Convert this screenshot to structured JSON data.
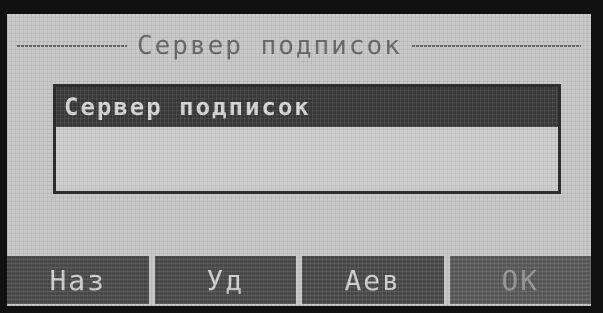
{
  "header": {
    "title": "Сервер подписок"
  },
  "field": {
    "selected_value": "Сервер подписок",
    "input_value": ""
  },
  "softkeys": [
    {
      "label": "Наз"
    },
    {
      "label": "Уд"
    },
    {
      "label": "Аев"
    },
    {
      "label": "OK"
    }
  ]
}
